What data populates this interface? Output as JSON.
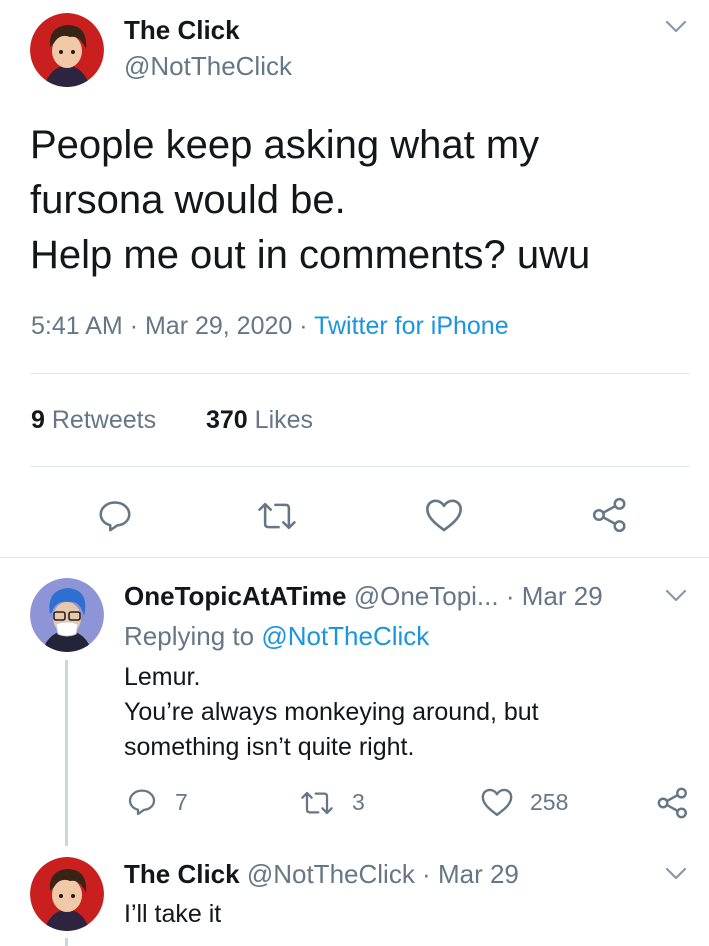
{
  "tweet": {
    "author_name": "The Click",
    "author_handle": "@NotTheClick",
    "text_line1": "People keep asking what my",
    "text_line2": "fursona would be.",
    "text_line3": "Help me out in comments? uwu",
    "time": "5:41 AM",
    "date": "Mar 29, 2020",
    "source": "Twitter for iPhone",
    "retweets_count": "9",
    "retweets_label": "Retweets",
    "likes_count": "370",
    "likes_label": "Likes"
  },
  "replies": [
    {
      "author_name": "OneTopicAtATime",
      "author_handle": "@OneTopi...",
      "date": "Mar 29",
      "replying_label": "Replying to",
      "replying_handle": "@NotTheClick",
      "text_line1": "Lemur.",
      "text_line2": "You’re always monkeying around, but",
      "text_line3": "something isn’t quite right.",
      "reply_count": "7",
      "retweet_count": "3",
      "like_count": "258"
    },
    {
      "author_name": "The Click",
      "author_handle": "@NotTheClick",
      "date": "Mar 29",
      "text_line1": "I’ll take it"
    }
  ],
  "separator": "·",
  "colors": {
    "link": "#1b95e0",
    "secondary": "#657786",
    "divider": "#e1e8ed"
  },
  "icons": [
    "chevron-down-icon",
    "reply-icon",
    "retweet-icon",
    "like-icon",
    "share-icon"
  ]
}
